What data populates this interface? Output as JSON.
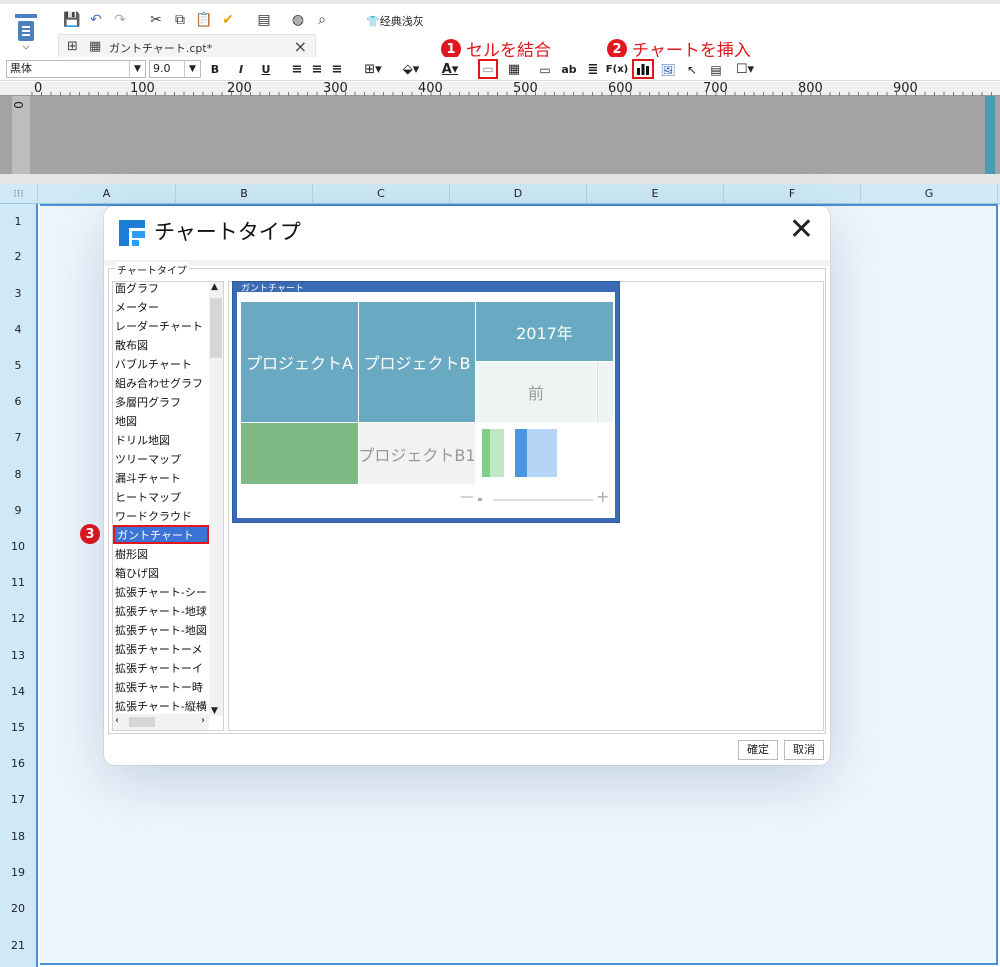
{
  "toolbar": {
    "style_toggle": "经典浅灰",
    "tab_title": "ガントチャート.cpt*"
  },
  "annotations": [
    {
      "num": "1",
      "text": "セルを結合"
    },
    {
      "num": "2",
      "text": "チャートを挿入"
    },
    {
      "num": "3"
    }
  ],
  "format": {
    "font": "黒体",
    "size": "9.0",
    "bold": "B",
    "italic": "I",
    "underline": "U",
    "text_tool": "ab",
    "formula": "F(x)"
  },
  "ruler": [
    "0",
    "100",
    "200",
    "300",
    "400",
    "500",
    "600",
    "700",
    "800",
    "900"
  ],
  "vertical_ruler": "0",
  "columns": [
    "A",
    "B",
    "C",
    "D",
    "E",
    "F",
    "G"
  ],
  "rows": [
    "1",
    "2",
    "3",
    "4",
    "5",
    "6",
    "7",
    "8",
    "9",
    "10",
    "11",
    "12",
    "13",
    "14",
    "15",
    "16",
    "17",
    "18",
    "19",
    "20",
    "21"
  ],
  "dialog": {
    "title": "チャートタイプ",
    "group_label": "チャートタイプ",
    "chart_types": [
      "面グラフ",
      "メーター",
      "レーダーチャート",
      "散布図",
      "バブルチャート",
      "組み合わせグラフ",
      "多層円グラフ",
      "地図",
      "ドリル地図",
      "ツリーマップ",
      "漏斗チャート",
      "ヒートマップ",
      "ワードクラウド",
      "ガントチャート",
      "樹形図",
      "箱ひげ図",
      "拡張チャート-シー",
      "拡張チャート-地球",
      "拡張チャート-地図",
      "拡張チャートーメ",
      "拡張チャートーイ",
      "拡張チャートー時",
      "拡張チャート-縦横"
    ],
    "selected": "ガントチャート",
    "preview_label": "ガントチャート",
    "preview": {
      "col1": "プロジェクトA",
      "col2": "プロジェクトB",
      "year": "2017年",
      "sub": "前",
      "row_label": "プロジェクトB1"
    },
    "ok": "確定",
    "cancel": "取消"
  },
  "colors": {
    "accent": "#3b74d6",
    "annotation": "#e1171e",
    "header_teal": "#6aa9c2",
    "green": "#7fba86"
  }
}
